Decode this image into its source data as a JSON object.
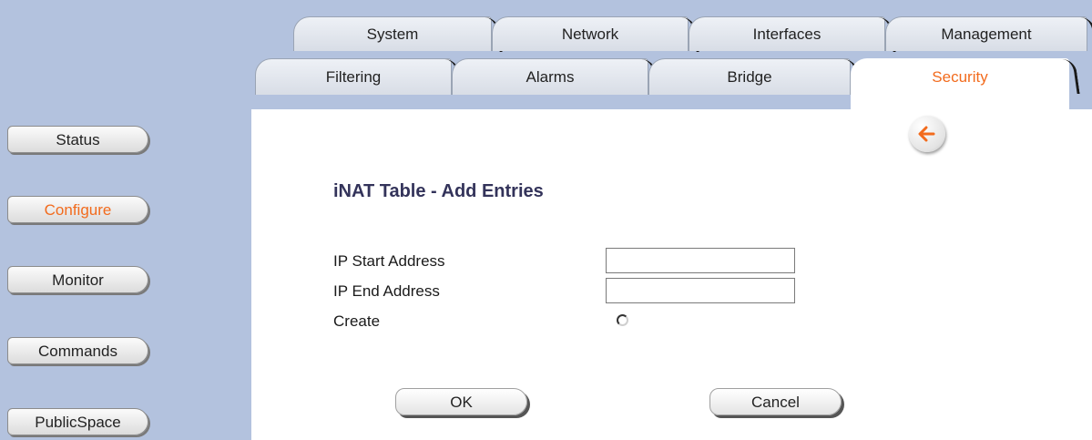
{
  "tabs_row1": [
    {
      "label": "System"
    },
    {
      "label": "Network"
    },
    {
      "label": "Interfaces"
    },
    {
      "label": "Management"
    }
  ],
  "tabs_row2": [
    {
      "label": "Filtering"
    },
    {
      "label": "Alarms"
    },
    {
      "label": "Bridge"
    },
    {
      "label": "Security",
      "active": true
    }
  ],
  "sidebar": {
    "items": [
      {
        "label": "Status"
      },
      {
        "label": "Configure",
        "active": true
      },
      {
        "label": "Monitor"
      },
      {
        "label": "Commands"
      },
      {
        "label": "PublicSpace"
      }
    ]
  },
  "main": {
    "title": "iNAT Table - Add Entries",
    "fields": [
      {
        "label": "IP Start Address",
        "value": ""
      },
      {
        "label": "IP End Address",
        "value": ""
      }
    ],
    "create_label": "Create",
    "ok_label": "OK",
    "cancel_label": "Cancel",
    "back_icon": "back-arrow-icon"
  },
  "colors": {
    "sidebar_bg": "#b3c2de",
    "active_text": "#f26b1d",
    "title_text": "#33335a"
  }
}
